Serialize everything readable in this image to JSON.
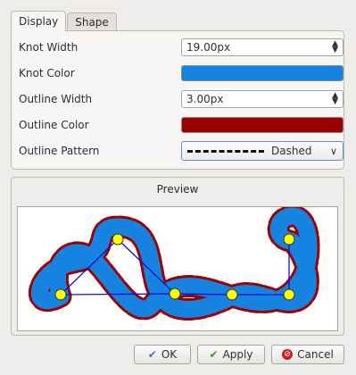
{
  "tabs": [
    {
      "label": "Display",
      "active": true
    },
    {
      "label": "Shape",
      "active": false
    }
  ],
  "display": {
    "knot_width": {
      "label": "Knot Width",
      "value": "19.00px"
    },
    "knot_color": {
      "label": "Knot Color",
      "color": "#1683e0"
    },
    "outline_width": {
      "label": "Outline Width",
      "value": "3.00px"
    },
    "outline_color": {
      "label": "Outline Color",
      "color": "#9b0000"
    },
    "outline_pattern": {
      "label": "Outline Pattern",
      "value": "Dashed"
    }
  },
  "preview": {
    "title": "Preview"
  },
  "buttons": {
    "ok": "OK",
    "apply": "Apply",
    "cancel": "Cancel"
  }
}
